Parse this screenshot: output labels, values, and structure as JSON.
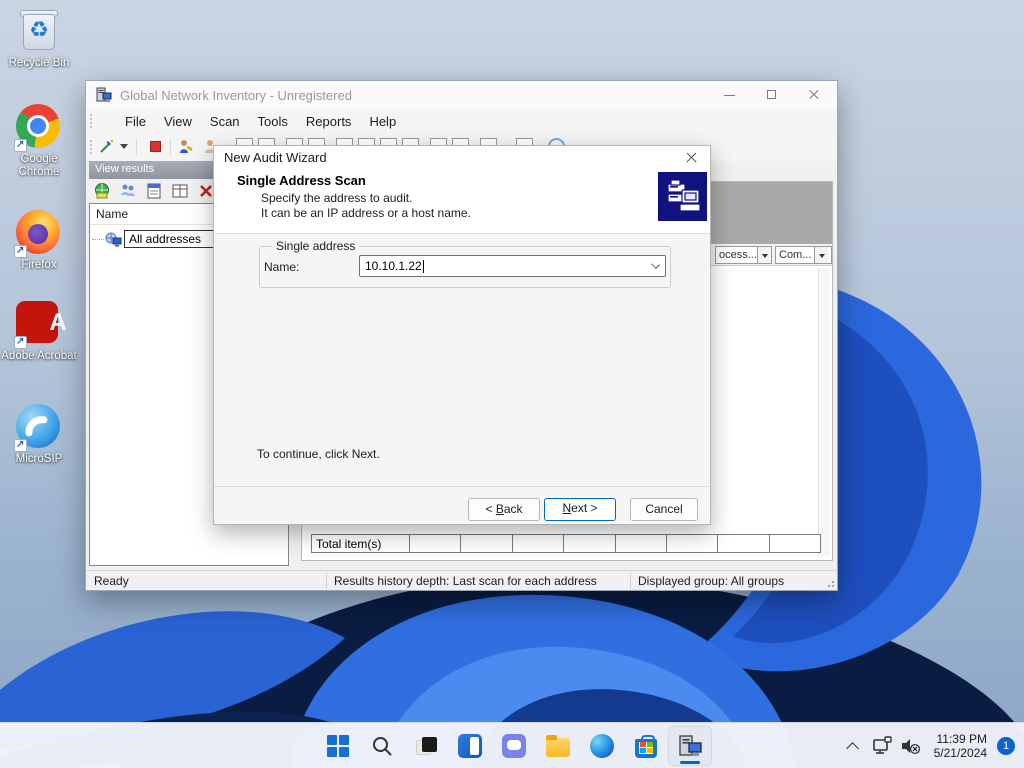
{
  "desktop": {
    "icons": [
      {
        "name": "recycle-bin",
        "icon": "recycle-bin-icon",
        "label": "Recycle Bin"
      },
      {
        "name": "google-chrome",
        "icon": "chrome-icon",
        "label": "Google Chrome"
      },
      {
        "name": "firefox",
        "icon": "firefox-icon",
        "label": "Firefox"
      },
      {
        "name": "adobe-acrobat",
        "icon": "acrobat-icon",
        "label": "Adobe Acrobat"
      },
      {
        "name": "microsip",
        "icon": "microsip-icon",
        "label": "MicroSIP"
      }
    ]
  },
  "app_window": {
    "title": "Global Network Inventory - Unregistered",
    "menu": [
      "File",
      "View",
      "Scan",
      "Tools",
      "Reports",
      "Help"
    ],
    "left_panel": {
      "caption": "View results",
      "tree_header": "Name",
      "tree_item": "All addresses"
    },
    "right_panel": {
      "col1": "ocess...",
      "col2": "Com..."
    },
    "summary_label": "Total  item(s)",
    "status": {
      "ready": "Ready",
      "history": "Results history depth: Last scan for each address",
      "group": "Displayed group: All groups"
    }
  },
  "wizard": {
    "title": "New Audit Wizard",
    "heading": "Single Address Scan",
    "desc1": "Specify the address to audit.",
    "desc2": "It can be an IP address or a host name.",
    "group_label": "Single address",
    "name_label": "Name:",
    "name_value": "10.10.1.22",
    "hint": "To continue, click Next.",
    "buttons": {
      "back_pre": "< ",
      "back_u": "B",
      "back_post": "ack",
      "next_u": "N",
      "next_post": "ext >",
      "cancel": "Cancel"
    }
  },
  "taskbar": {
    "icons": [
      "start-icon",
      "search-icon",
      "task-view-icon",
      "widgets-icon",
      "chat-icon",
      "file-explorer-icon",
      "edge-icon",
      "store-icon",
      "gni-app-icon"
    ],
    "tray": {
      "icons": [
        "chevron-up-icon",
        "network-icon",
        "volume-muted-icon"
      ],
      "time": "11:39 PM",
      "date": "5/21/2024",
      "badge": "1"
    }
  },
  "colors": {
    "accent": "#0067c0",
    "wizard_icon_bg": "#10127e",
    "badge": "#0b64d0",
    "taskbar_bg": "#f1f4fa"
  }
}
